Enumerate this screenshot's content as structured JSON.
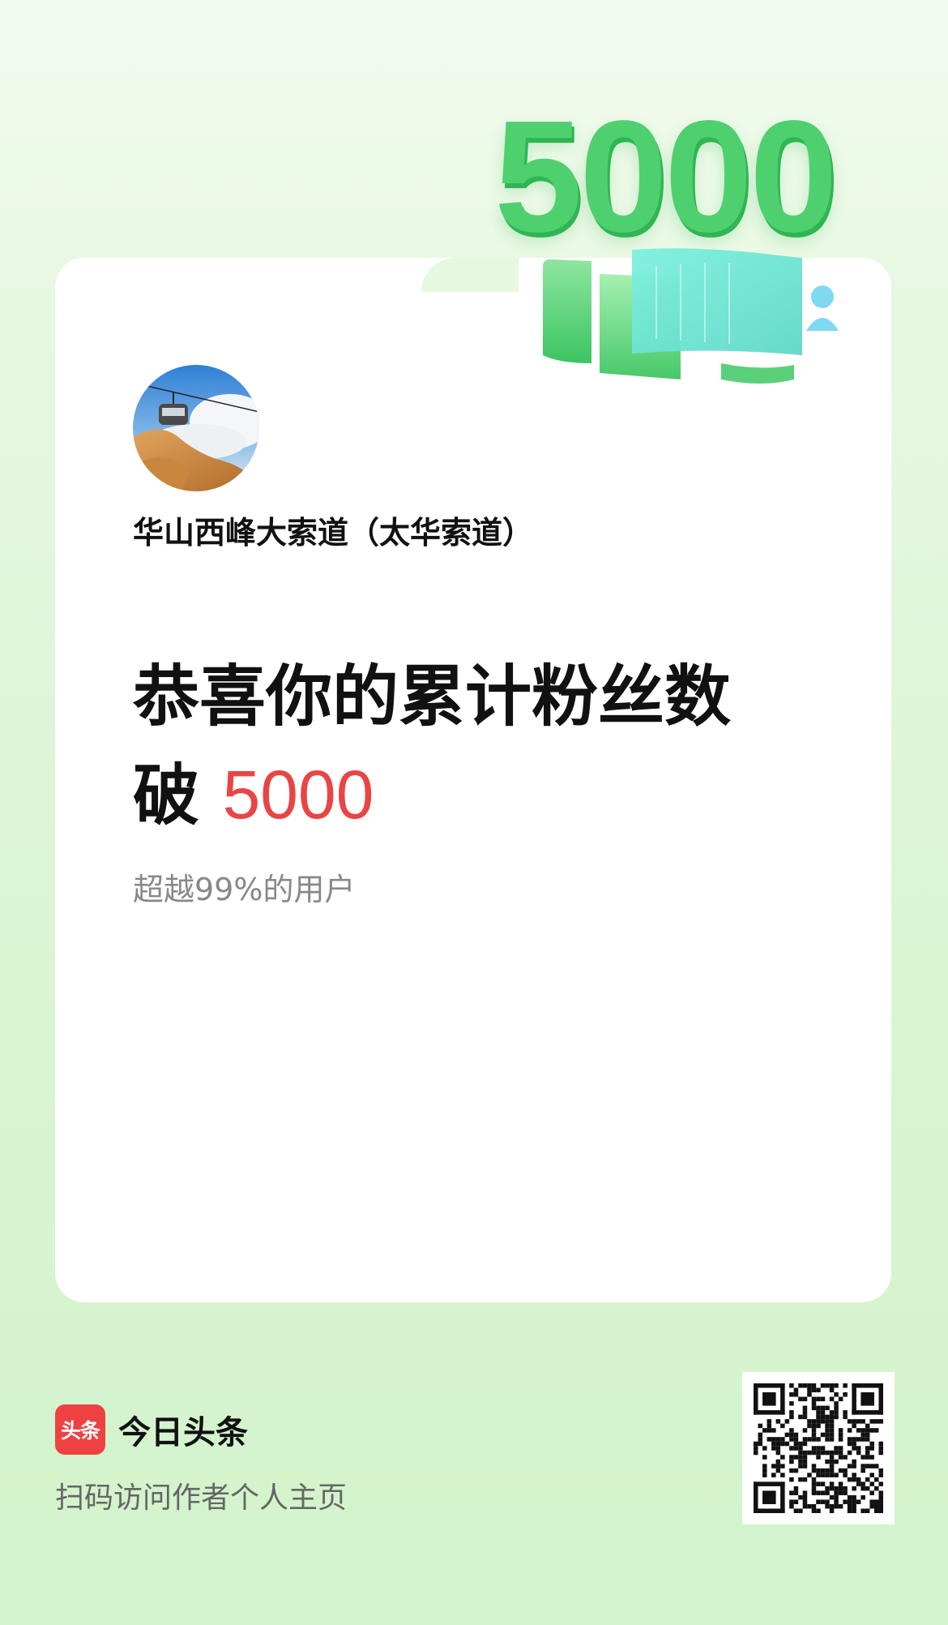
{
  "badge": {
    "number": "5000"
  },
  "author": {
    "name": "华山西峰大索道（太华索道）",
    "avatar_icon": "cable-car-avatar"
  },
  "headline": {
    "line1": "恭喜你的累计粉丝数",
    "line2_prefix": "破",
    "count": "5000"
  },
  "subtext": "超越99%的用户",
  "footer": {
    "brand_logo_text": "头条",
    "brand_name": "今日头条",
    "hint": "扫码访问作者个人主页",
    "qr_icon": "qr-code-icon"
  },
  "colors": {
    "accent_green": "#4fd06e",
    "highlight_red": "#e84545",
    "brand_red": "#f04142"
  }
}
